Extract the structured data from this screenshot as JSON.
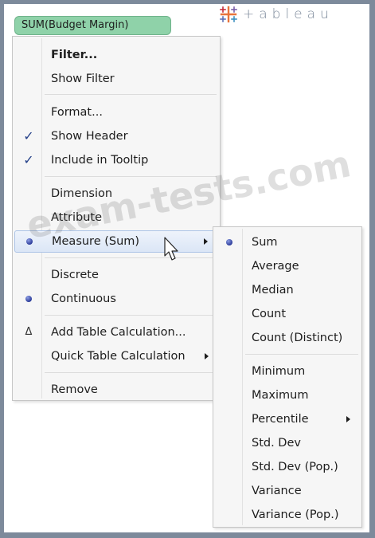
{
  "pill": {
    "label": "SUM(Budget Margin)"
  },
  "logo": {
    "text": "+ableau",
    "icon": "tableau-plus-mark-icon"
  },
  "context_menu": {
    "items": [
      {
        "label": "Filter...",
        "bold": true
      },
      {
        "label": "Show Filter"
      },
      {
        "label": "Format..."
      },
      {
        "label": "Show Header",
        "glyph": "check-icon",
        "checked": true
      },
      {
        "label": "Include in Tooltip",
        "glyph": "check-icon",
        "checked": true
      },
      {
        "label": "Dimension"
      },
      {
        "label": "Attribute"
      },
      {
        "label": "Measure (Sum)",
        "glyph": "radio-dot-icon",
        "selected": true,
        "submenu": true,
        "highlighted": true
      },
      {
        "label": "Discrete"
      },
      {
        "label": "Continuous",
        "glyph": "radio-dot-icon",
        "selected": true
      },
      {
        "label": "Add Table Calculation...",
        "glyph": "delta-icon",
        "glyph_char": "Δ"
      },
      {
        "label": "Quick Table Calculation",
        "submenu": true
      },
      {
        "label": "Remove"
      }
    ]
  },
  "measure_submenu": {
    "items": [
      {
        "label": "Sum",
        "glyph": "radio-dot-icon",
        "selected": true
      },
      {
        "label": "Average"
      },
      {
        "label": "Median"
      },
      {
        "label": "Count"
      },
      {
        "label": "Count (Distinct)"
      },
      {
        "label": "Minimum"
      },
      {
        "label": "Maximum"
      },
      {
        "label": "Percentile",
        "submenu": true
      },
      {
        "label": "Std. Dev"
      },
      {
        "label": "Std. Dev (Pop.)"
      },
      {
        "label": "Variance"
      },
      {
        "label": "Variance (Pop.)"
      }
    ]
  },
  "watermark": {
    "text": "exam-tests.com"
  },
  "colors": {
    "pill_fill": "#8fd2a9",
    "check": "#26428a",
    "radio_dot": "#2c3c9a",
    "hover_border": "#adc4e6",
    "logo": "#7d8a9b"
  }
}
